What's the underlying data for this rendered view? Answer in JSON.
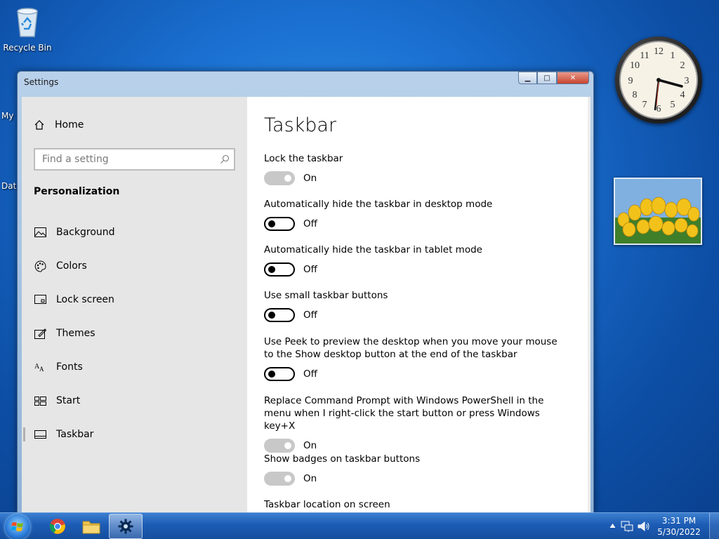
{
  "desktop": {
    "recycle_bin_label": "Recycle Bin",
    "partial_label_1": "My",
    "partial_label_2": "Dat"
  },
  "window": {
    "title": "Settings",
    "buttons": {
      "minimize": "▁",
      "maximize": "□",
      "close": "✕"
    }
  },
  "nav": {
    "home_label": "Home",
    "search_placeholder": "Find a setting",
    "section_title": "Personalization",
    "items": [
      {
        "label": "Background",
        "icon": "image-icon"
      },
      {
        "label": "Colors",
        "icon": "palette-icon"
      },
      {
        "label": "Lock screen",
        "icon": "lock-screen-icon"
      },
      {
        "label": "Themes",
        "icon": "themes-icon"
      },
      {
        "label": "Fonts",
        "icon": "fonts-icon"
      },
      {
        "label": "Start",
        "icon": "start-icon"
      },
      {
        "label": "Taskbar",
        "icon": "taskbar-icon",
        "active": true
      }
    ]
  },
  "main": {
    "title": "Taskbar",
    "settings": [
      {
        "label": "Lock the taskbar",
        "state": "On"
      },
      {
        "label": "Automatically hide the taskbar in desktop mode",
        "state": "Off"
      },
      {
        "label": "Automatically hide the taskbar in tablet mode",
        "state": "Off"
      },
      {
        "label": "Use small taskbar buttons",
        "state": "Off"
      },
      {
        "label": "Use Peek to preview the desktop when you move your mouse to the Show desktop button at the end of the taskbar",
        "state": "Off"
      },
      {
        "label": "Replace Command Prompt with Windows PowerShell in the menu when I right-click the start button or press Windows key+X",
        "state": "On"
      },
      {
        "label": "Show badges on taskbar buttons",
        "state": "On"
      }
    ],
    "next_heading": "Taskbar location on screen"
  },
  "clock": {
    "numerals": [
      "12",
      "1",
      "2",
      "3",
      "4",
      "5",
      "6",
      "7",
      "8",
      "9",
      "10",
      "11"
    ]
  },
  "taskbar": {
    "time": "3:31 PM",
    "date": "5/30/2022"
  },
  "colors": {
    "accent": "#1d5cb5",
    "toggle_on": "#c8c8c8",
    "nav_bg": "#e6e6e6"
  }
}
